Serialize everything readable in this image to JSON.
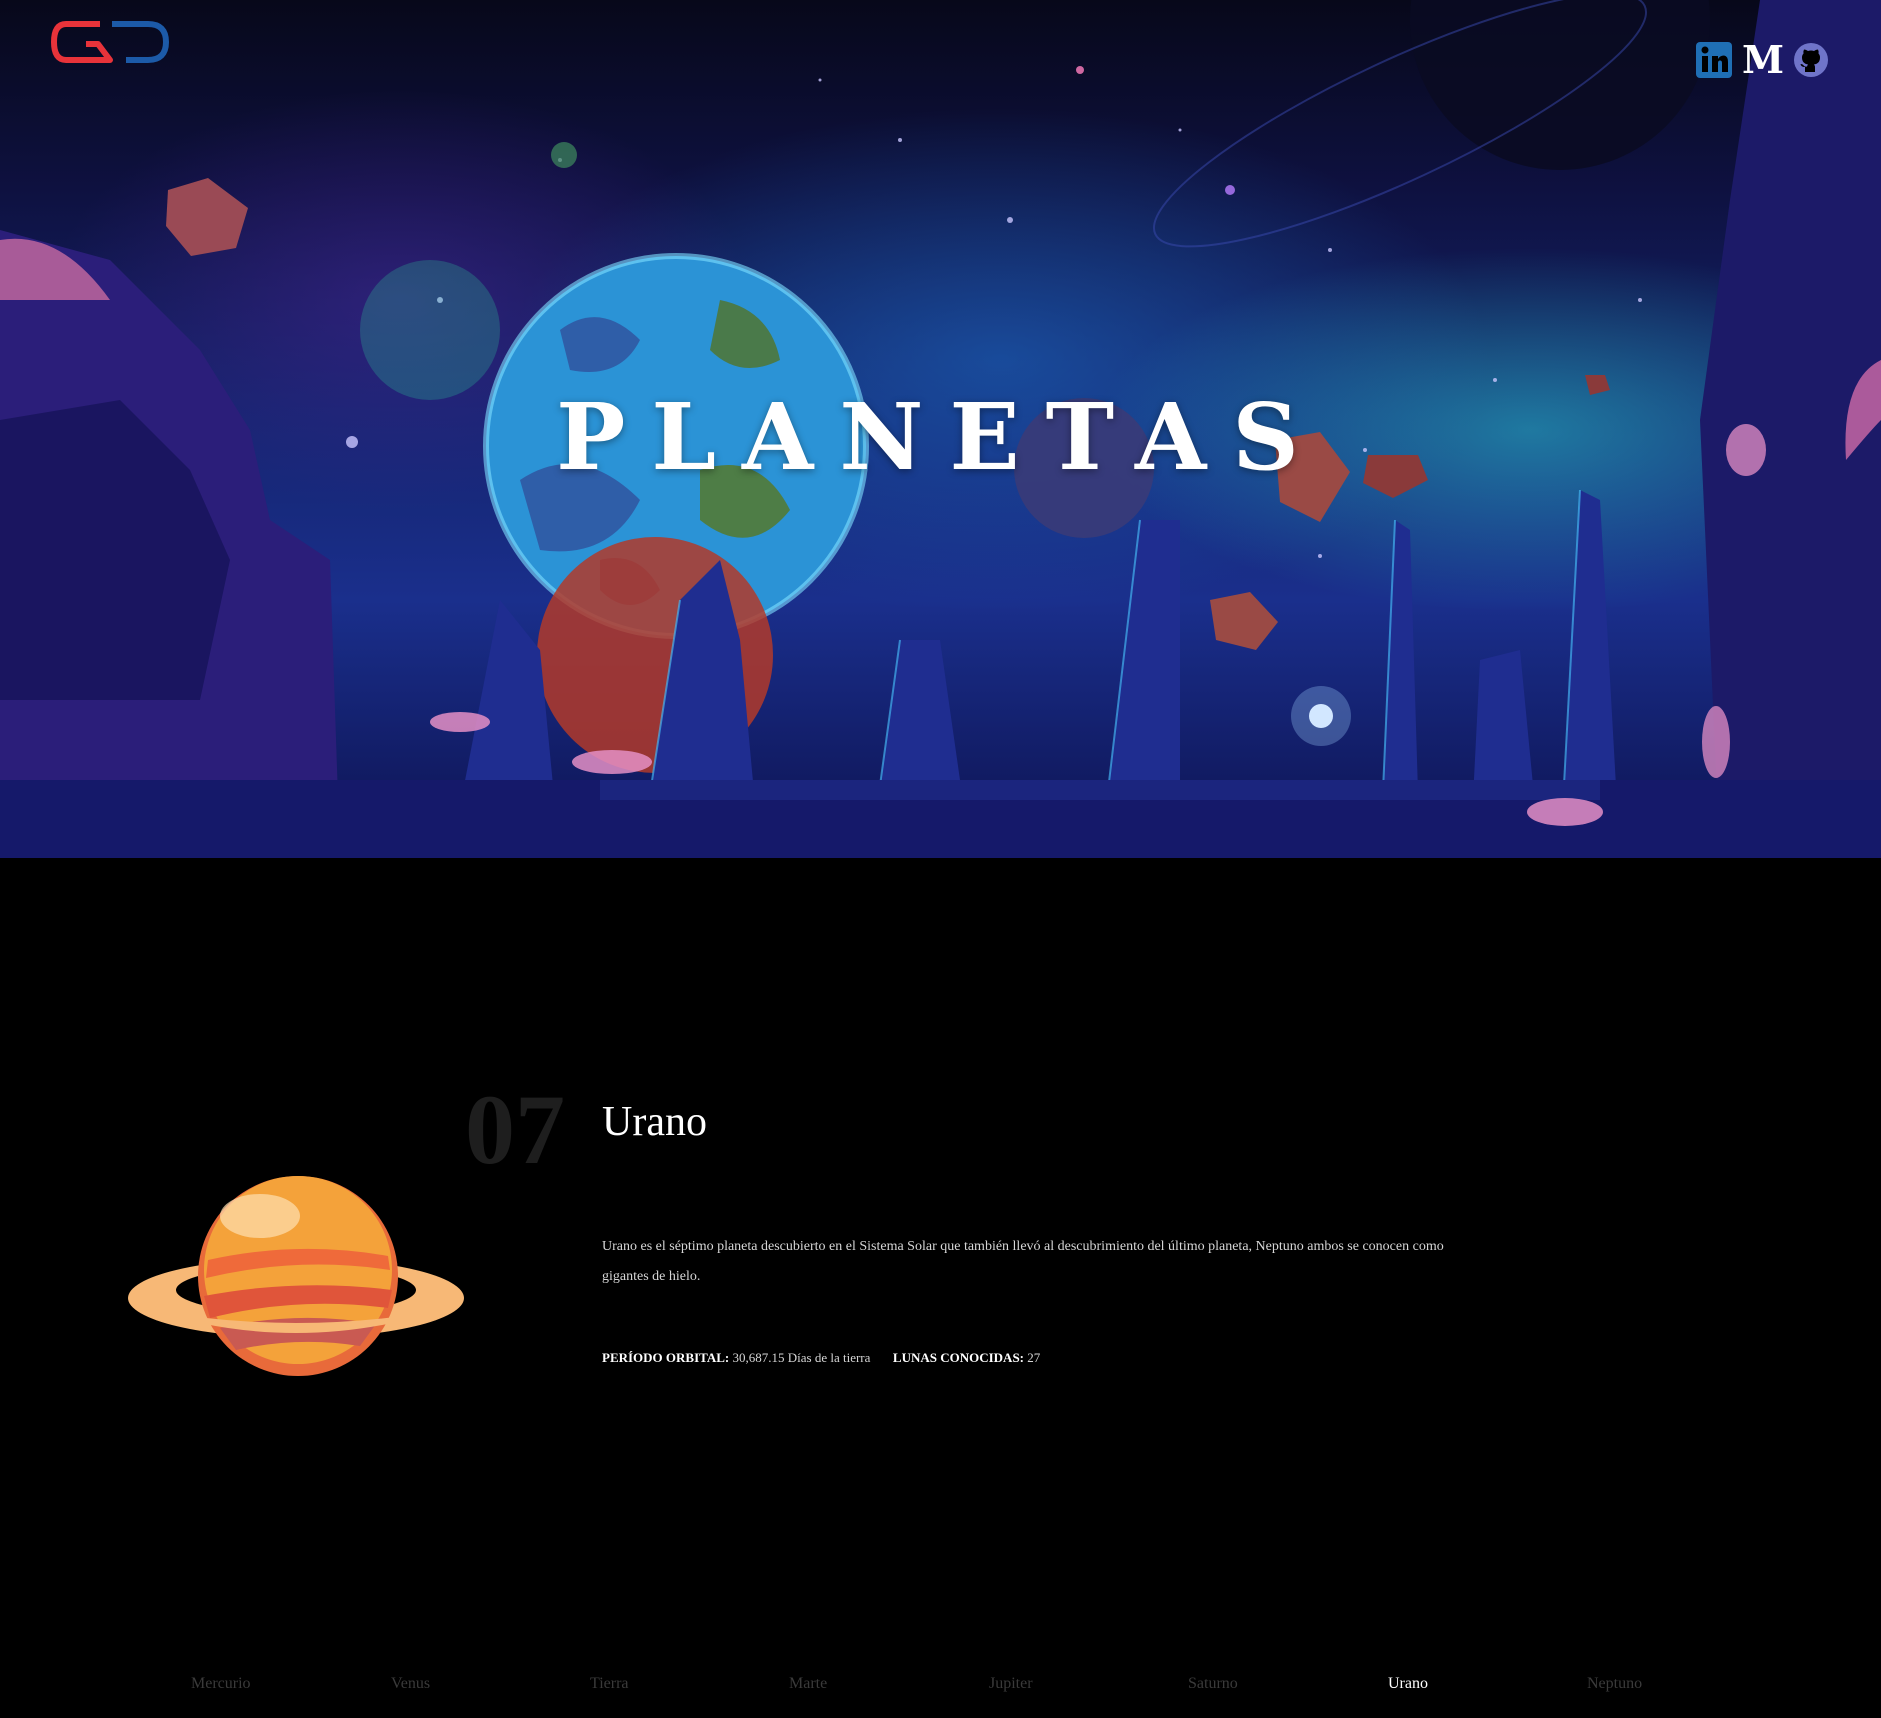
{
  "brand": {
    "logo_icon": "gd-logo-icon",
    "colors": {
      "red": "#e8333a",
      "blue": "#1c5aa8"
    }
  },
  "social": [
    {
      "name": "linkedin",
      "icon": "linkedin-icon",
      "color": "#1f6fb5"
    },
    {
      "name": "medium",
      "icon": "medium-icon",
      "glyph": "M",
      "color": "#ffffff"
    },
    {
      "name": "github",
      "icon": "github-icon",
      "color": "#6f74c9"
    }
  ],
  "hero": {
    "title": "PLANETAS"
  },
  "planet": {
    "number": "07",
    "name": "Urano",
    "description": "Urano es el séptimo planeta descubierto en el Sistema Solar que también llevó al descubrimiento del último planeta, Neptuno ambos se conocen como gigantes de hielo.",
    "orbital_label": "PERÍODO ORBITAL:",
    "orbital_value": "30,687.15 Días de la tierra",
    "moons_label": "LUNAS CONOCIDAS:",
    "moons_value": "27"
  },
  "nav": {
    "items": [
      "Mercurio",
      "Venus",
      "Tierra",
      "Marte",
      "Jupiter",
      "Saturno",
      "Urano",
      "Neptuno"
    ],
    "active": "Urano"
  }
}
